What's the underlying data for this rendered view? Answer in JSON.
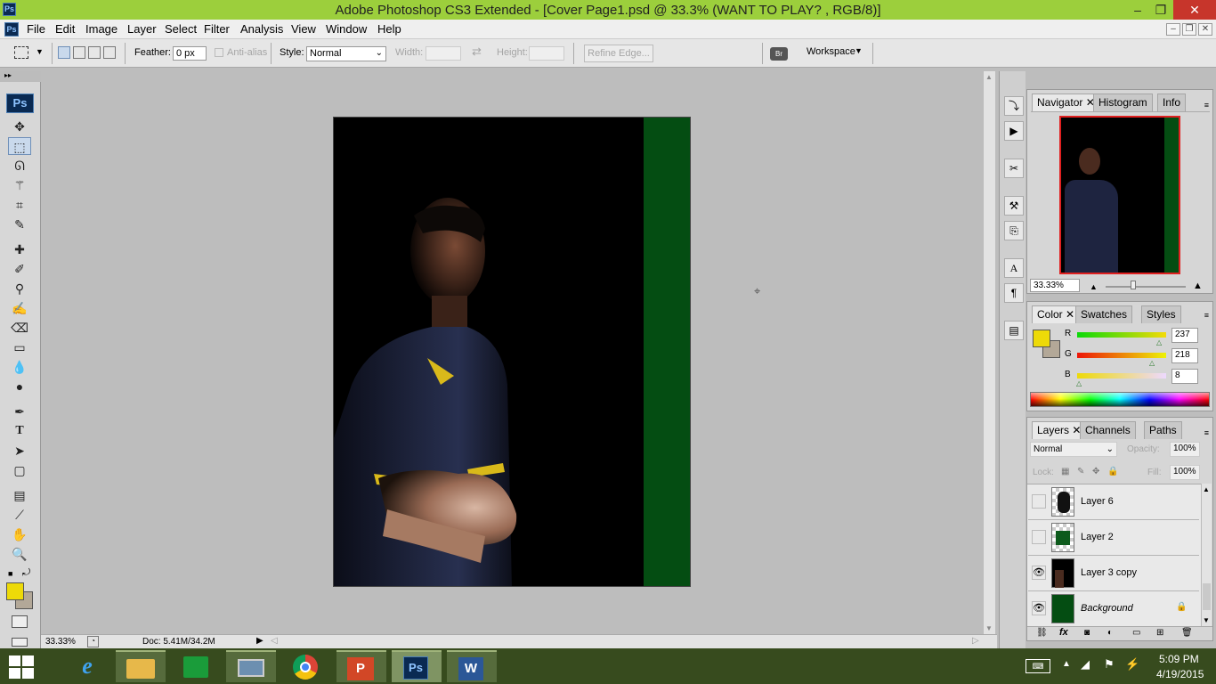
{
  "window": {
    "title": "Adobe Photoshop CS3 Extended - [Cover Page1.psd @ 33.3% (WANT TO PLAY? , RGB/8)]",
    "minimize": "‒",
    "maximize": "❐",
    "close": "✕"
  },
  "app_logo": "Ps",
  "menu": [
    "File",
    "Edit",
    "Image",
    "Layer",
    "Select",
    "Filter",
    "Analysis",
    "View",
    "Window",
    "Help"
  ],
  "options": {
    "feather_label": "Feather:",
    "feather_value": "0 px",
    "antialias_label": "Anti-alias",
    "style_label": "Style:",
    "style_value": "Normal",
    "width_label": "Width:",
    "height_label": "Height:",
    "refine_edge": "Refine Edge...",
    "workspace": "Workspace"
  },
  "status": {
    "zoom": "33.33%",
    "doc": "Doc: 5.41M/34.2M"
  },
  "navigator": {
    "tabs": [
      "Navigator",
      "Histogram",
      "Info"
    ],
    "zoom": "33.33%"
  },
  "color": {
    "tabs": [
      "Color",
      "Swatches",
      "Styles"
    ],
    "channels": [
      {
        "label": "R",
        "value": "237"
      },
      {
        "label": "G",
        "value": "218"
      },
      {
        "label": "B",
        "value": "8"
      }
    ],
    "foreground": "#edda08",
    "background": "#b3a898"
  },
  "layers": {
    "tabs": [
      "Layers",
      "Channels",
      "Paths"
    ],
    "blend_mode": "Normal",
    "opacity_label": "Opacity:",
    "opacity": "100%",
    "lock_label": "Lock:",
    "fill_label": "Fill:",
    "fill": "100%",
    "items": [
      {
        "name": "Layer 6",
        "visible": false
      },
      {
        "name": "Layer 2",
        "visible": false
      },
      {
        "name": "Layer 3 copy",
        "visible": true
      },
      {
        "name": "Background",
        "visible": true
      }
    ]
  },
  "taskbar": {
    "items": [
      "start-button",
      "internet-explorer",
      "file-explorer",
      "store",
      "remote-desktop",
      "chrome",
      "powerpoint",
      "photoshop",
      "word"
    ],
    "labels": {
      "photoshop": "Ps",
      "word": "W",
      "powerpoint": "P"
    },
    "time": "5:09 PM",
    "date": "4/19/2015"
  }
}
